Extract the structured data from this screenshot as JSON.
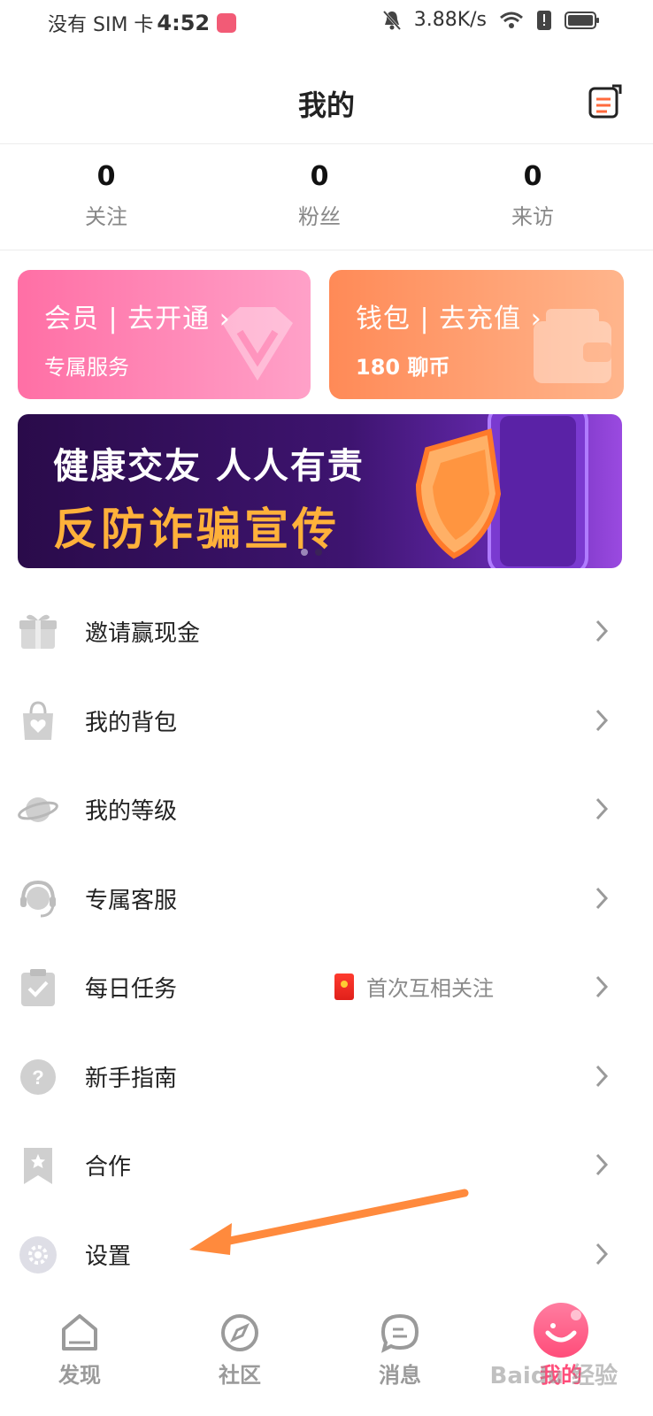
{
  "status": {
    "carrier": "没有 SIM 卡",
    "time": "4:52",
    "speed": "3.88K/s"
  },
  "header": {
    "title": "我的"
  },
  "stats": [
    {
      "value": "0",
      "label": "关注"
    },
    {
      "value": "0",
      "label": "粉丝"
    },
    {
      "value": "0",
      "label": "来访"
    }
  ],
  "cards": {
    "vip": {
      "title": "会员 | 去开通 ›",
      "subtitle": "专属服务"
    },
    "wallet": {
      "title": "钱包 | 去充值 ›",
      "subtitle": "180 聊币"
    }
  },
  "banner": {
    "line1": "健康交友  人人有责",
    "line2": "反防诈骗宣传"
  },
  "menu": [
    {
      "label": "邀请赢现金",
      "icon": "gift-icon"
    },
    {
      "label": "我的背包",
      "icon": "bag-icon"
    },
    {
      "label": "我的等级",
      "icon": "planet-icon"
    },
    {
      "label": "专属客服",
      "icon": "customer-service-icon"
    },
    {
      "label": "每日任务",
      "icon": "task-check-icon",
      "extra": "首次互相关注"
    },
    {
      "label": "新手指南",
      "icon": "help-icon"
    },
    {
      "label": "合作",
      "icon": "bookmark-star-icon"
    },
    {
      "label": "设置",
      "icon": "gear-icon"
    }
  ],
  "tabs": [
    {
      "label": "发现",
      "icon": "home-icon"
    },
    {
      "label": "社区",
      "icon": "compass-icon"
    },
    {
      "label": "消息",
      "icon": "message-icon"
    },
    {
      "label": "我的",
      "icon": "profile-icon",
      "active": true
    }
  ],
  "watermark": "Baidu 经验",
  "colors": {
    "accent_pink": "#ff4d7a",
    "vip_gradient": "#ff6fa5",
    "wallet_gradient": "#ff8a57",
    "banner_purple": "#3e1470",
    "annotation_arrow": "#ff8a3d"
  }
}
